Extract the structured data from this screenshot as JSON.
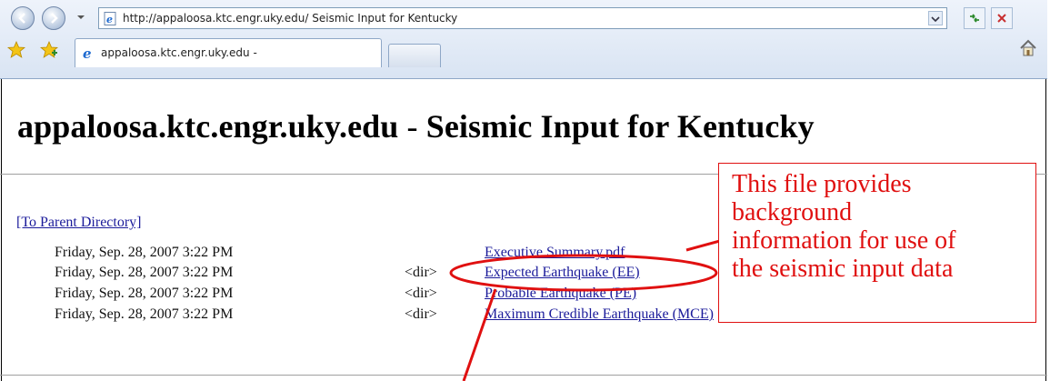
{
  "browser": {
    "address_text": "http://appaloosa.ktc.engr.uky.edu/ Seismic Input for Kentucky",
    "tab_label": "appaloosa.ktc.engr.uky.edu -"
  },
  "page": {
    "title_host": "appaloosa.ktc.engr.uky.edu",
    "title_sep": "-",
    "title_name": "Seismic Input for Kentucky",
    "parent_link": "[To Parent Directory]",
    "rows": [
      {
        "date": "Friday, Sep. 28, 2007 3:22 PM",
        "dir": "",
        "name": "Executive Summary.pdf"
      },
      {
        "date": "Friday, Sep. 28, 2007 3:22 PM",
        "dir": "<dir>",
        "name": "Expected Earthquake (EE)"
      },
      {
        "date": "Friday, Sep. 28, 2007 3:22 PM",
        "dir": "<dir>",
        "name": "Probable Earthquake (PE)"
      },
      {
        "date": "Friday, Sep. 28, 2007 3:22 PM",
        "dir": "<dir>",
        "name": "Maximum Credible Earthquake (MCE)"
      }
    ]
  },
  "annotation": {
    "lines": [
      "This file provides",
      "background",
      "information for use of",
      "the seismic input data"
    ],
    "color": "#e01010"
  }
}
